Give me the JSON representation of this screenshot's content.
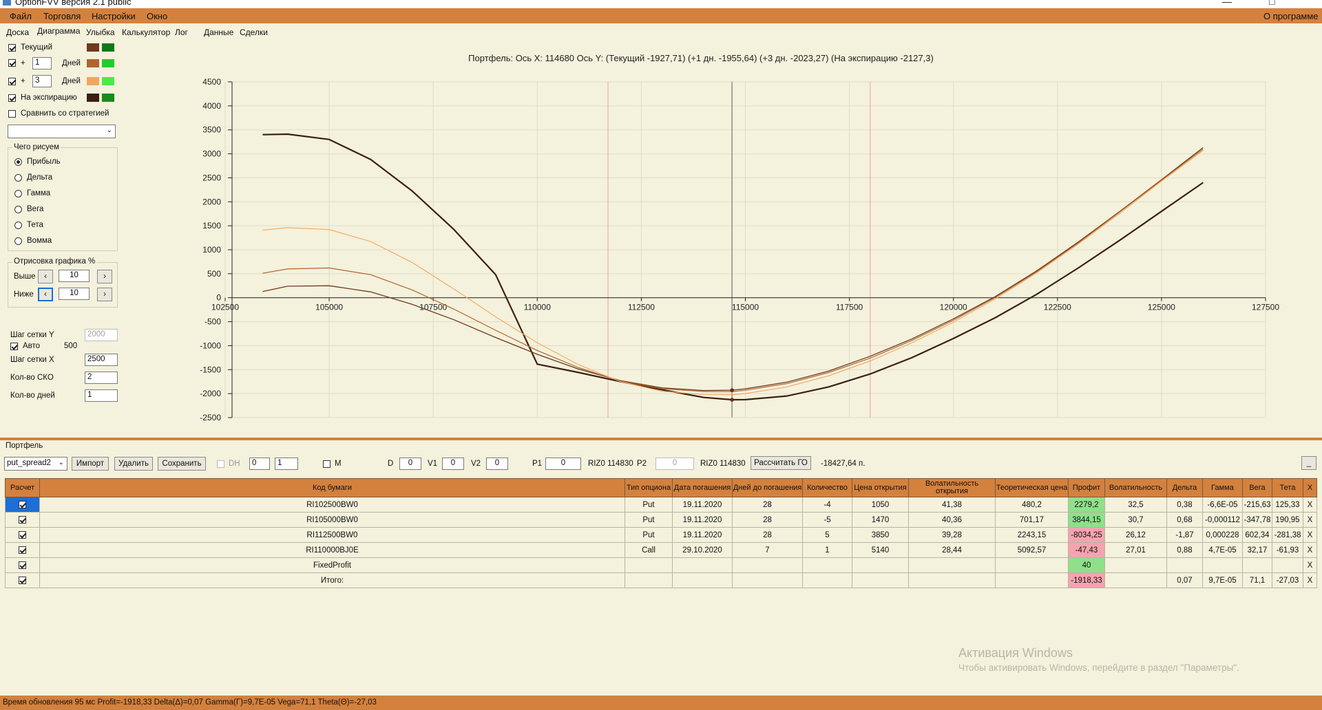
{
  "window": {
    "title": "OptionFVV версия 2.1 public",
    "minimize": "—",
    "maximize": "□"
  },
  "menu": {
    "file": "Файл",
    "trade": "Торговля",
    "settings": "Настройки",
    "window": "Окно",
    "about": "О программе"
  },
  "tabs": [
    "Доска",
    "Диаграмма",
    "Улыбка",
    "Калькулятор",
    "Лог",
    "Данные",
    "Сделки"
  ],
  "left": {
    "current_label": "Текущий",
    "plus1": {
      "sign": "+",
      "value": "1",
      "unit": "Дней"
    },
    "plus3": {
      "sign": "+",
      "value": "3",
      "unit": "Дней"
    },
    "expiration_label": "На экспирацию",
    "compare_label": "Сравнить со стратегией",
    "what_group": "Чего рисуем",
    "radios": [
      "Прибыль",
      "Дельта",
      "Гамма",
      "Вега",
      "Тета",
      "Вомма"
    ],
    "draw_group": "Отрисовка графика %",
    "above_label": "Выше",
    "above_value": "10",
    "below_label": "Ниже",
    "below_value": "10",
    "step_y_label": "Шаг сетки Y",
    "step_y_value": "2000",
    "auto_label": "Авто",
    "auto_value": "500",
    "step_x_label": "Шаг сетки X",
    "step_x_value": "2500",
    "sko_label": "Кол-во СКО",
    "sko_value": "2",
    "days_label": "Кол-во дней",
    "days_value": "1"
  },
  "colors": {
    "current_loss": "#6b3a1f",
    "current_profit": "#0a7a1a",
    "plus1_loss": "#b0652f",
    "plus1_profit": "#20cc30",
    "plus3_loss": "#f0a860",
    "plus3_profit": "#44ee44",
    "exp_loss": "#3a2010",
    "exp_profit": "#1a8a1a"
  },
  "chart_data": {
    "type": "line",
    "title": "Портфель: Ось X: 114680 Ось Y: (Текущий -1927,71) (+1 дн. -1955,64) (+3 дн. -2023,27) (На экспирацию -2127,3)",
    "xlim": [
      102500,
      127500
    ],
    "ylim": [
      -2500,
      4500
    ],
    "x_ticks": [
      102500,
      105000,
      107500,
      110000,
      112500,
      115000,
      117500,
      120000,
      122500,
      125000,
      127500
    ],
    "y_ticks": [
      4500,
      4000,
      3500,
      3000,
      2500,
      2000,
      1500,
      1000,
      500,
      0,
      -500,
      -1000,
      -1500,
      -2000,
      -2500
    ],
    "cursor_x": 114680,
    "red_lines_x": [
      111700,
      118000
    ],
    "grid": true,
    "series": [
      {
        "color": "#3a2010",
        "width": 2.2,
        "x": [
          103400,
          104000,
          105000,
          106000,
          107000,
          108000,
          109000,
          110000,
          111000,
          112000,
          113000,
          114000,
          114680,
          115000,
          116000,
          117000,
          118000,
          119000,
          120000,
          121000,
          122000,
          123000,
          124000,
          125000,
          126000
        ],
        "y": [
          3400,
          3410,
          3300,
          2880,
          2220,
          1420,
          480,
          -1385,
          -1560,
          -1750,
          -1920,
          -2080,
          -2127,
          -2125,
          -2050,
          -1860,
          -1590,
          -1250,
          -850,
          -420,
          70,
          620,
          1200,
          1800,
          2400
        ]
      },
      {
        "color": "#6b3a1f",
        "width": 1.3,
        "x": [
          103400,
          104000,
          105000,
          106000,
          107000,
          108000,
          109000,
          110000,
          111000,
          112000,
          113000,
          114000,
          114680,
          115000,
          116000,
          117000,
          118000,
          119000,
          120000,
          121000,
          122000,
          123000,
          124000,
          125000,
          126000
        ],
        "y": [
          130,
          240,
          250,
          120,
          -140,
          -460,
          -830,
          -1180,
          -1490,
          -1730,
          -1880,
          -1935,
          -1928,
          -1900,
          -1760,
          -1530,
          -1220,
          -860,
          -440,
          20,
          560,
          1160,
          1800,
          2460,
          3130
        ]
      },
      {
        "color": "#b0652f",
        "width": 1.2,
        "x": [
          103400,
          104000,
          105000,
          106000,
          107000,
          108000,
          109000,
          110000,
          111000,
          112000,
          113000,
          114000,
          114680,
          115000,
          116000,
          117000,
          118000,
          119000,
          120000,
          121000,
          122000,
          123000,
          124000,
          125000,
          126000
        ],
        "y": [
          510,
          600,
          620,
          480,
          160,
          -240,
          -680,
          -1100,
          -1460,
          -1740,
          -1900,
          -1955,
          -1956,
          -1930,
          -1790,
          -1560,
          -1260,
          -890,
          -470,
          0,
          540,
          1140,
          1790,
          2450,
          3100
        ]
      },
      {
        "color": "#f0a860",
        "width": 1.1,
        "x": [
          103400,
          104000,
          105000,
          106000,
          107000,
          108000,
          109000,
          110000,
          111000,
          112000,
          113000,
          114000,
          114680,
          115000,
          116000,
          117000,
          118000,
          119000,
          120000,
          121000,
          122000,
          123000,
          124000,
          125000,
          126000
        ],
        "y": [
          1410,
          1460,
          1420,
          1170,
          730,
          180,
          -400,
          -940,
          -1400,
          -1750,
          -1950,
          -2020,
          -2023,
          -2000,
          -1860,
          -1630,
          -1320,
          -940,
          -510,
          -30,
          520,
          1120,
          1760,
          2430,
          3070
        ]
      }
    ]
  },
  "portfolio": {
    "group_label": "Портфель",
    "combo_value": "put_spread2",
    "import_btn": "Импорт",
    "delete_btn": "Удалить",
    "save_btn": "Сохранить",
    "dh_label": "DH",
    "spin1": "0",
    "spin2": "1",
    "m_label": "M",
    "d_label": "D",
    "d_value": "0",
    "v1_label": "V1",
    "v1_value": "0",
    "v2_label": "V2",
    "v2_value": "0",
    "p1_label": "P1",
    "p1_value": "0",
    "riz1": "RIZ0 114830",
    "p2_label": "P2",
    "p2_value": "0",
    "riz2": "RIZ0 114830",
    "go_btn": "Рассчитать ГО",
    "go_value": "-18427,64 п.",
    "collapse_btn": "_"
  },
  "table": {
    "headers": [
      "Расчет",
      "Код бумаги",
      "Тип опциона",
      "Дата погашения",
      "Дней до погашения",
      "Количество",
      "Цена открытия",
      "Волатильность открытия",
      "Теоретическая цена",
      "Профит",
      "Волатильность",
      "Дельта",
      "Гамма",
      "Вега",
      "Тета",
      "X"
    ],
    "rows": [
      [
        "",
        "RI102500BW0",
        "Put",
        "19.11.2020",
        "28",
        "-4",
        "1050",
        "41,38",
        "480,2",
        "2279,2",
        "32,5",
        "0,38",
        "-6,6E-05",
        "-215,63",
        "125,33",
        "X"
      ],
      [
        "",
        "RI105000BW0",
        "Put",
        "19.11.2020",
        "28",
        "-5",
        "1470",
        "40,36",
        "701,17",
        "3844,15",
        "30,7",
        "0,68",
        "-0,000112",
        "-347,78",
        "190,95",
        "X"
      ],
      [
        "",
        "RI112500BW0",
        "Put",
        "19.11.2020",
        "28",
        "5",
        "3850",
        "39,28",
        "2243,15",
        "-8034,25",
        "26,12",
        "-1,87",
        "0,000228",
        "602,34",
        "-281,38",
        "X"
      ],
      [
        "",
        "RI110000BJ0E",
        "Call",
        "29.10.2020",
        "7",
        "1",
        "5140",
        "28,44",
        "5092,57",
        "-47,43",
        "27,01",
        "0,88",
        "4,7E-05",
        "32,17",
        "-61,93",
        "X"
      ],
      [
        "",
        "FixedProfit",
        "",
        "",
        "",
        "",
        "",
        "",
        "",
        "40",
        "",
        "",
        "",
        "",
        "",
        "X"
      ],
      [
        "",
        "Итого:",
        "",
        "",
        "",
        "",
        "",
        "",
        "",
        "-1918,33",
        "",
        "0,07",
        "9,7E-05",
        "71,1",
        "-27,03",
        "X"
      ]
    ]
  },
  "watermark": {
    "line1": "Активация Windows",
    "line2": "Чтобы активировать Windows, перейдите в раздел \"Параметры\"."
  },
  "status": "Время обновления 95 мс  Profit=-1918,33 Delta(Δ)=0,07 Gamma(Γ)=9,7E-05 Vega=71,1 Theta(Θ)=-27,03"
}
